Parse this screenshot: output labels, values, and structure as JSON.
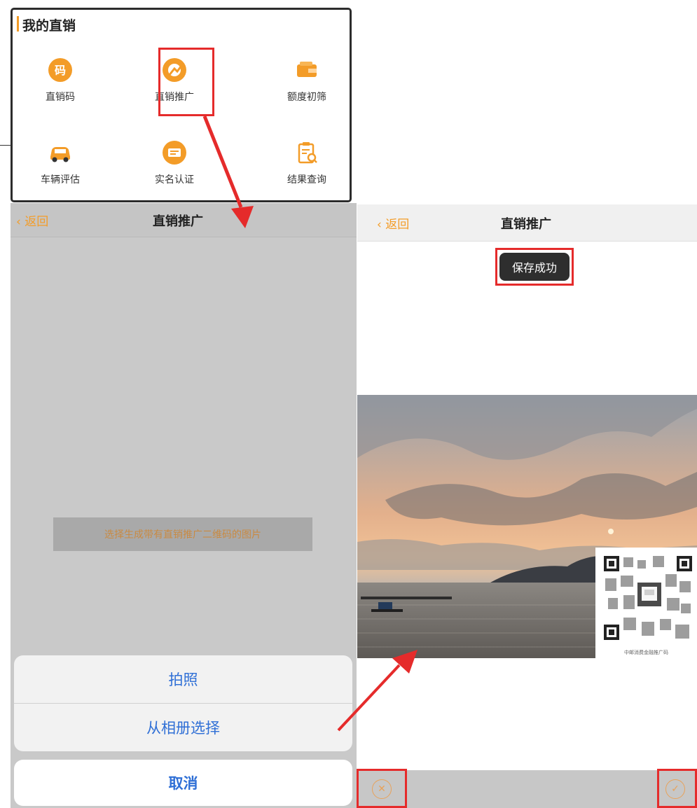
{
  "menu": {
    "title": "我的直销",
    "items": [
      {
        "label": "直销码",
        "icon": "qr-code-icon"
      },
      {
        "label": "直销推广",
        "icon": "promotion-icon"
      },
      {
        "label": "额度初筛",
        "icon": "wallet-icon"
      },
      {
        "label": "车辆评估",
        "icon": "car-icon"
      },
      {
        "label": "实名认证",
        "icon": "id-card-icon"
      },
      {
        "label": "结果查询",
        "icon": "clipboard-search-icon"
      }
    ],
    "accent": "#f39c28"
  },
  "left_screen": {
    "back_label": "返回",
    "title": "直销推广",
    "prompt": "选择生成带有直销推广二维码的图片",
    "sheet": {
      "take_photo": "拍照",
      "choose_album": "从相册选择",
      "cancel": "取消"
    }
  },
  "right_screen": {
    "back_label": "返回",
    "title": "直销推广",
    "toast": "保存成功",
    "photo_subject": "sunset-sea-landscape",
    "qr_caption": "中邮消费金融推广码",
    "cancel_icon": "close-circle-icon",
    "confirm_icon": "check-circle-icon"
  },
  "colors": {
    "highlight": "#e52b2b",
    "link_blue": "#2f6fd6"
  }
}
